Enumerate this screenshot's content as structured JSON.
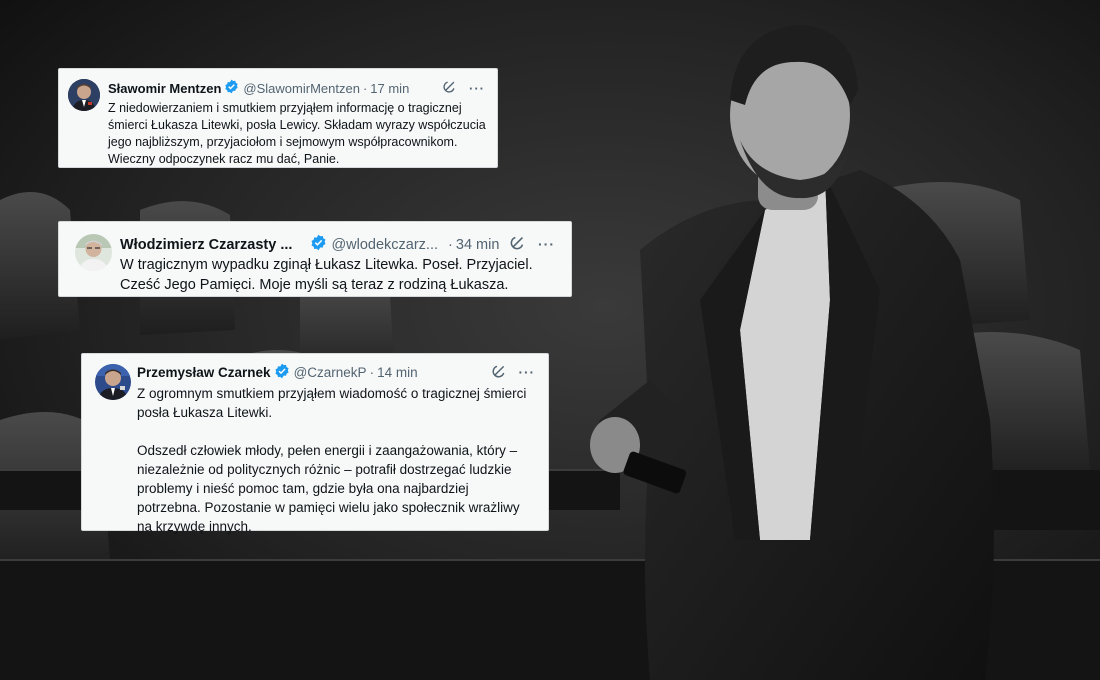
{
  "colors": {
    "card_background": "#f7f9f9",
    "verified_badge": "#1d9bf0",
    "name_text": "#0f1419",
    "meta_text": "#536471"
  },
  "tweets": [
    {
      "name": "Sławomir Mentzen",
      "handle": "@SlawomirMentzen",
      "separator": "·",
      "time": "17 min",
      "verified": true,
      "action_icons": [
        "grok-icon",
        "more-icon"
      ],
      "more_label": "···",
      "paragraphs": [
        "Z niedowierzaniem i smutkiem przyjąłem informację o tragicznej śmierci Łukasza Litewki, posła Lewicy. Składam wyrazy współczucia jego najbliższym, przyjaciołom i sejmowym współpracownikom. Wieczny odpoczynek racz mu dać, Panie."
      ]
    },
    {
      "name": "Włodzimierz Czarzasty ...",
      "handle": "@wlodekczarz...",
      "separator": "·",
      "time": "34 min",
      "verified": true,
      "action_icons": [
        "grok-icon",
        "more-icon"
      ],
      "more_label": "···",
      "paragraphs": [
        "W tragicznym wypadku zginął Łukasz Litewka. Poseł. Przyjaciel. Cześć Jego Pamięci. Moje myśli są teraz z rodziną Łukasza."
      ]
    },
    {
      "name": "Przemysław Czarnek",
      "handle": "@CzarnekP",
      "separator": "·",
      "time": "14 min",
      "verified": true,
      "action_icons": [
        "grok-icon",
        "more-icon"
      ],
      "more_label": "···",
      "paragraphs": [
        "Z ogromnym smutkiem przyjąłem wiadomość o tragicznej śmierci posła Łukasza Litewki.",
        "Odszedł człowiek młody, pełen energii i zaangażowania, który – niezależnie od politycznych różnic – potrafił dostrzegać ludzkie problemy i nieść pomoc tam, gdzie była ona najbardziej potrzebna. Pozostanie w pamięci wielu jako społecznik wrażliwy na krzywdę innych."
      ]
    }
  ]
}
